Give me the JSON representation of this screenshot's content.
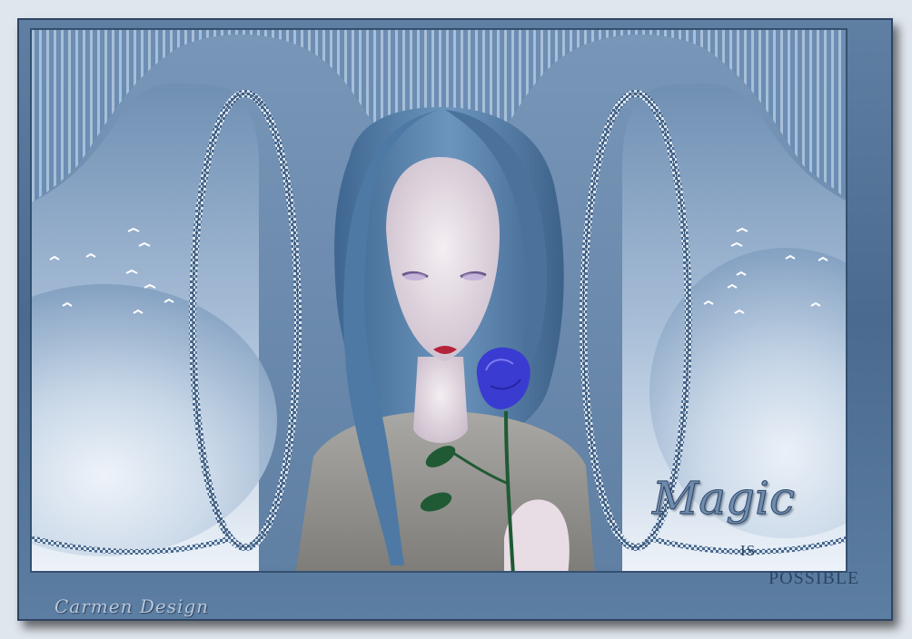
{
  "artwork": {
    "title_word": "Magic",
    "subtitle_line1": "IS",
    "subtitle_line2": "POSSIBLE",
    "signature": "Carmen Design"
  },
  "colors": {
    "frame": "#4f6f94",
    "sky_light": "#e6eef6",
    "sky_mid": "#9fb5cf",
    "hair": "#5b84ad",
    "rose": "#3a3bd1",
    "text": "#2c4563"
  },
  "icons": [
    "bird-icon",
    "rose-icon"
  ]
}
